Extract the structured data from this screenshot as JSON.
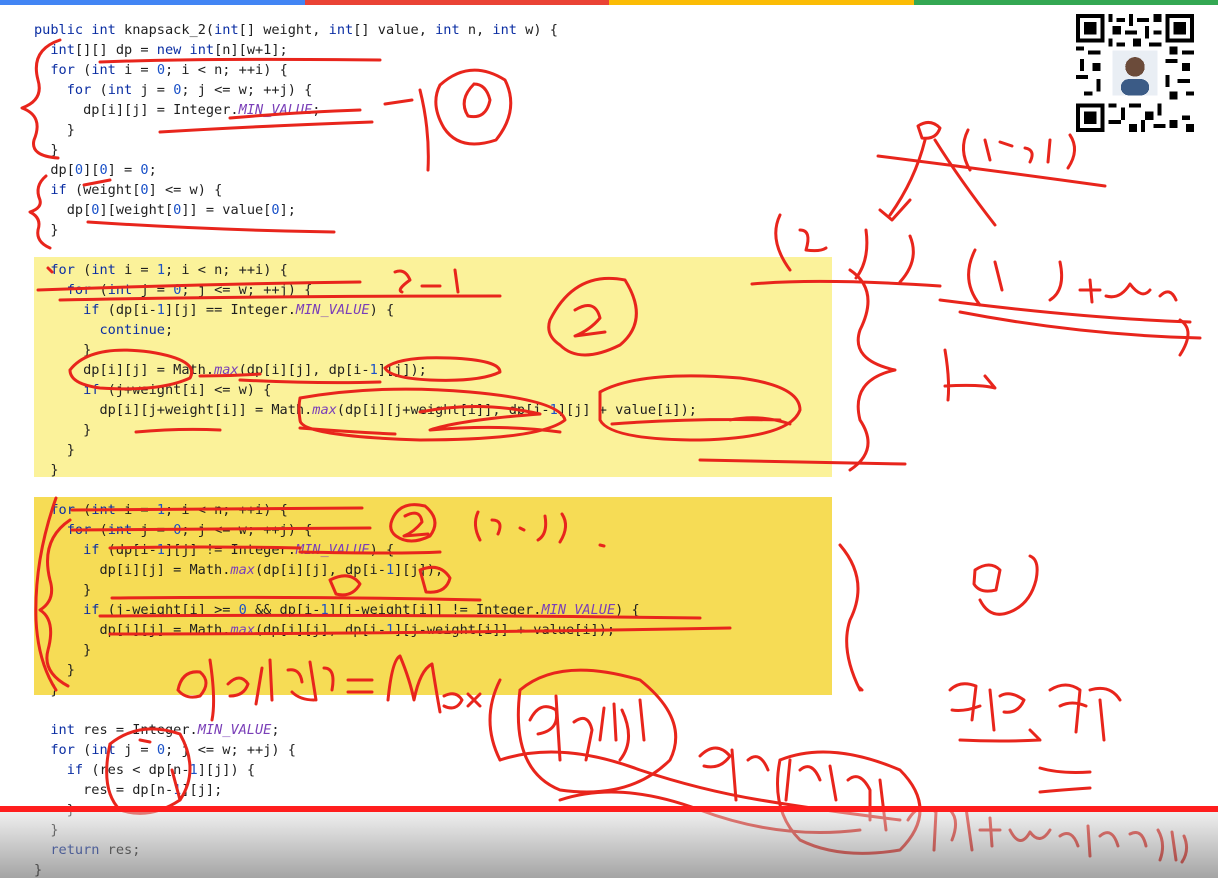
{
  "colors": {
    "keyword": "#0b2ea3",
    "constant": "#7a3fb8",
    "highlight_light": "#fbf29a",
    "highlight_dark": "#f6dc55",
    "ink": "#e8251c",
    "progress": "#ff1e1e",
    "topbar": [
      "#4285f4",
      "#ea4335",
      "#fbbc05",
      "#34a853"
    ]
  },
  "icons": [
    "qr-code-icon"
  ],
  "player": {
    "progress_fraction": 1.0
  },
  "code": {
    "lines": [
      {
        "segs": [
          [
            "kw",
            "public "
          ],
          [
            "kw",
            "int "
          ],
          [
            "p",
            "knapsack_2("
          ],
          [
            "kw",
            "int"
          ],
          [
            "p",
            "[] weight, "
          ],
          [
            "kw",
            "int"
          ],
          [
            "p",
            "[] value, "
          ],
          [
            "kw",
            "int "
          ],
          [
            "p",
            "n, "
          ],
          [
            "kw",
            "int "
          ],
          [
            "p",
            "w) {"
          ]
        ]
      },
      {
        "segs": [
          [
            "p",
            "  "
          ],
          [
            "kw",
            "int"
          ],
          [
            "p",
            "[][] dp = "
          ],
          [
            "kw",
            "new int"
          ],
          [
            "p",
            "[n][w+1];"
          ]
        ]
      },
      {
        "segs": [
          [
            "p",
            "  "
          ],
          [
            "kw",
            "for "
          ],
          [
            "p",
            "("
          ],
          [
            "kw",
            "int "
          ],
          [
            "p",
            "i = "
          ],
          [
            "num",
            "0"
          ],
          [
            "p",
            "; i < n; ++i) {"
          ]
        ]
      },
      {
        "segs": [
          [
            "p",
            "    "
          ],
          [
            "kw",
            "for "
          ],
          [
            "p",
            "("
          ],
          [
            "kw",
            "int "
          ],
          [
            "p",
            "j = "
          ],
          [
            "num",
            "0"
          ],
          [
            "p",
            "; j <= w; ++j) {"
          ]
        ]
      },
      {
        "segs": [
          [
            "p",
            "      dp[i][j] = Integer."
          ],
          [
            "it",
            "MIN_VALUE"
          ],
          [
            "p",
            ";"
          ]
        ]
      },
      {
        "segs": [
          [
            "p",
            "    }"
          ]
        ]
      },
      {
        "segs": [
          [
            "p",
            "  }"
          ]
        ]
      },
      {
        "segs": [
          [
            "p",
            "  dp["
          ],
          [
            "num",
            "0"
          ],
          [
            "p",
            "]["
          ],
          [
            "num",
            "0"
          ],
          [
            "p",
            "] = "
          ],
          [
            "num",
            "0"
          ],
          [
            "p",
            ";"
          ]
        ]
      },
      {
        "segs": [
          [
            "p",
            "  "
          ],
          [
            "kw",
            "if "
          ],
          [
            "p",
            "(weight["
          ],
          [
            "num",
            "0"
          ],
          [
            "p",
            "] <= w) {"
          ]
        ]
      },
      {
        "segs": [
          [
            "p",
            "    dp["
          ],
          [
            "num",
            "0"
          ],
          [
            "p",
            "][weight["
          ],
          [
            "num",
            "0"
          ],
          [
            "p",
            "]] = value["
          ],
          [
            "num",
            "0"
          ],
          [
            "p",
            "];"
          ]
        ]
      },
      {
        "segs": [
          [
            "p",
            "  }"
          ]
        ]
      },
      {
        "segs": [
          [
            "p",
            ""
          ]
        ]
      },
      {
        "segs": [
          [
            "p",
            "  "
          ],
          [
            "kw",
            "for "
          ],
          [
            "p",
            "("
          ],
          [
            "kw",
            "int "
          ],
          [
            "p",
            "i = "
          ],
          [
            "num",
            "1"
          ],
          [
            "p",
            "; i < n; ++i) {"
          ]
        ]
      },
      {
        "segs": [
          [
            "p",
            "    "
          ],
          [
            "kw",
            "for "
          ],
          [
            "p",
            "("
          ],
          [
            "kw",
            "int "
          ],
          [
            "p",
            "j = "
          ],
          [
            "num",
            "0"
          ],
          [
            "p",
            "; j <= w; ++j) {"
          ]
        ]
      },
      {
        "segs": [
          [
            "p",
            "      "
          ],
          [
            "kw",
            "if "
          ],
          [
            "p",
            "(dp[i-"
          ],
          [
            "num",
            "1"
          ],
          [
            "p",
            "][j] == Integer."
          ],
          [
            "it",
            "MIN_VALUE"
          ],
          [
            "p",
            ") {"
          ]
        ]
      },
      {
        "segs": [
          [
            "p",
            "        "
          ],
          [
            "kw",
            "continue"
          ],
          [
            "p",
            ";"
          ]
        ]
      },
      {
        "segs": [
          [
            "p",
            "      }"
          ]
        ]
      },
      {
        "segs": [
          [
            "p",
            "      dp[i][j] = Math."
          ],
          [
            "it",
            "max"
          ],
          [
            "p",
            "(dp[i][j], dp[i-"
          ],
          [
            "num",
            "1"
          ],
          [
            "p",
            "][j]);"
          ]
        ]
      },
      {
        "segs": [
          [
            "p",
            "      "
          ],
          [
            "kw",
            "if "
          ],
          [
            "p",
            "(j+weight[i] <= w) {"
          ]
        ]
      },
      {
        "segs": [
          [
            "p",
            "        dp[i][j+weight[i]] = Math."
          ],
          [
            "it",
            "max"
          ],
          [
            "p",
            "(dp[i][j+weight[i]], dp[i-"
          ],
          [
            "num",
            "1"
          ],
          [
            "p",
            "][j] + value[i]);"
          ]
        ]
      },
      {
        "segs": [
          [
            "p",
            "      }"
          ]
        ]
      },
      {
        "segs": [
          [
            "p",
            "    }"
          ]
        ]
      },
      {
        "segs": [
          [
            "p",
            "  }"
          ]
        ]
      },
      {
        "segs": [
          [
            "p",
            ""
          ]
        ]
      },
      {
        "segs": [
          [
            "p",
            "  "
          ],
          [
            "kw",
            "for "
          ],
          [
            "p",
            "("
          ],
          [
            "kw",
            "int "
          ],
          [
            "p",
            "i = "
          ],
          [
            "num",
            "1"
          ],
          [
            "p",
            "; i < n; ++i) {"
          ]
        ]
      },
      {
        "segs": [
          [
            "p",
            "    "
          ],
          [
            "kw",
            "for "
          ],
          [
            "p",
            "("
          ],
          [
            "kw",
            "int "
          ],
          [
            "p",
            "j = "
          ],
          [
            "num",
            "0"
          ],
          [
            "p",
            "; j <= w; ++j) {"
          ]
        ]
      },
      {
        "segs": [
          [
            "p",
            "      "
          ],
          [
            "kw",
            "if "
          ],
          [
            "p",
            "(dp[i-"
          ],
          [
            "num",
            "1"
          ],
          [
            "p",
            "][j] != Integer."
          ],
          [
            "it",
            "MIN_VALUE"
          ],
          [
            "p",
            ") {"
          ]
        ]
      },
      {
        "segs": [
          [
            "p",
            "        dp[i][j] = Math."
          ],
          [
            "it",
            "max"
          ],
          [
            "p",
            "(dp[i][j], dp[i-"
          ],
          [
            "num",
            "1"
          ],
          [
            "p",
            "][j]);"
          ]
        ]
      },
      {
        "segs": [
          [
            "p",
            "      }"
          ]
        ]
      },
      {
        "segs": [
          [
            "p",
            "      "
          ],
          [
            "kw",
            "if "
          ],
          [
            "p",
            "(j-weight[i] >= "
          ],
          [
            "num",
            "0"
          ],
          [
            "p",
            " && dp[i-"
          ],
          [
            "num",
            "1"
          ],
          [
            "p",
            "][j-weight[i]] != Integer."
          ],
          [
            "it",
            "MIN_VALUE"
          ],
          [
            "p",
            ") {"
          ]
        ]
      },
      {
        "segs": [
          [
            "p",
            "        dp[i][j] = Math."
          ],
          [
            "it",
            "max"
          ],
          [
            "p",
            "(dp[i][j], dp[i-"
          ],
          [
            "num",
            "1"
          ],
          [
            "p",
            "][j-weight[i]] + value[i]);"
          ]
        ]
      },
      {
        "segs": [
          [
            "p",
            "      }"
          ]
        ]
      },
      {
        "segs": [
          [
            "p",
            "    }"
          ]
        ]
      },
      {
        "segs": [
          [
            "p",
            "  }"
          ]
        ]
      },
      {
        "segs": [
          [
            "p",
            ""
          ]
        ]
      },
      {
        "segs": [
          [
            "p",
            "  "
          ],
          [
            "kw",
            "int "
          ],
          [
            "p",
            "res = Integer."
          ],
          [
            "it",
            "MIN_VALUE"
          ],
          [
            "p",
            ";"
          ]
        ]
      },
      {
        "segs": [
          [
            "p",
            "  "
          ],
          [
            "kw",
            "for "
          ],
          [
            "p",
            "("
          ],
          [
            "kw",
            "int "
          ],
          [
            "p",
            "j = "
          ],
          [
            "num",
            "0"
          ],
          [
            "p",
            "; j <= w; ++j) {"
          ]
        ]
      },
      {
        "segs": [
          [
            "p",
            "    "
          ],
          [
            "kw",
            "if "
          ],
          [
            "p",
            "(res < dp[n-"
          ],
          [
            "num",
            "1"
          ],
          [
            "p",
            "][j]) {"
          ]
        ]
      },
      {
        "segs": [
          [
            "p",
            "      res = dp[n-"
          ],
          [
            "num",
            "1"
          ],
          [
            "p",
            "][j];"
          ]
        ]
      },
      {
        "segs": [
          [
            "p",
            "    }"
          ]
        ]
      },
      {
        "segs": [
          [
            "p",
            "  }"
          ]
        ]
      },
      {
        "segs": [
          [
            "p",
            "  "
          ],
          [
            "kw",
            "return "
          ],
          [
            "p",
            "res;"
          ]
        ]
      },
      {
        "segs": [
          [
            "p",
            "}"
          ]
        ]
      }
    ]
  },
  "handwriting": [
    "①",
    "②",
    "②",
    "(i-1, j)",
    "(i, j)",
    "(i, j+weight[i])",
    "i-1",
    "(i, j)",
    "dp[i][j] = Max (dp[i-1][j], dp[i-1][j-weight[i]] + value[i])",
    "思",
    "推 反"
  ]
}
